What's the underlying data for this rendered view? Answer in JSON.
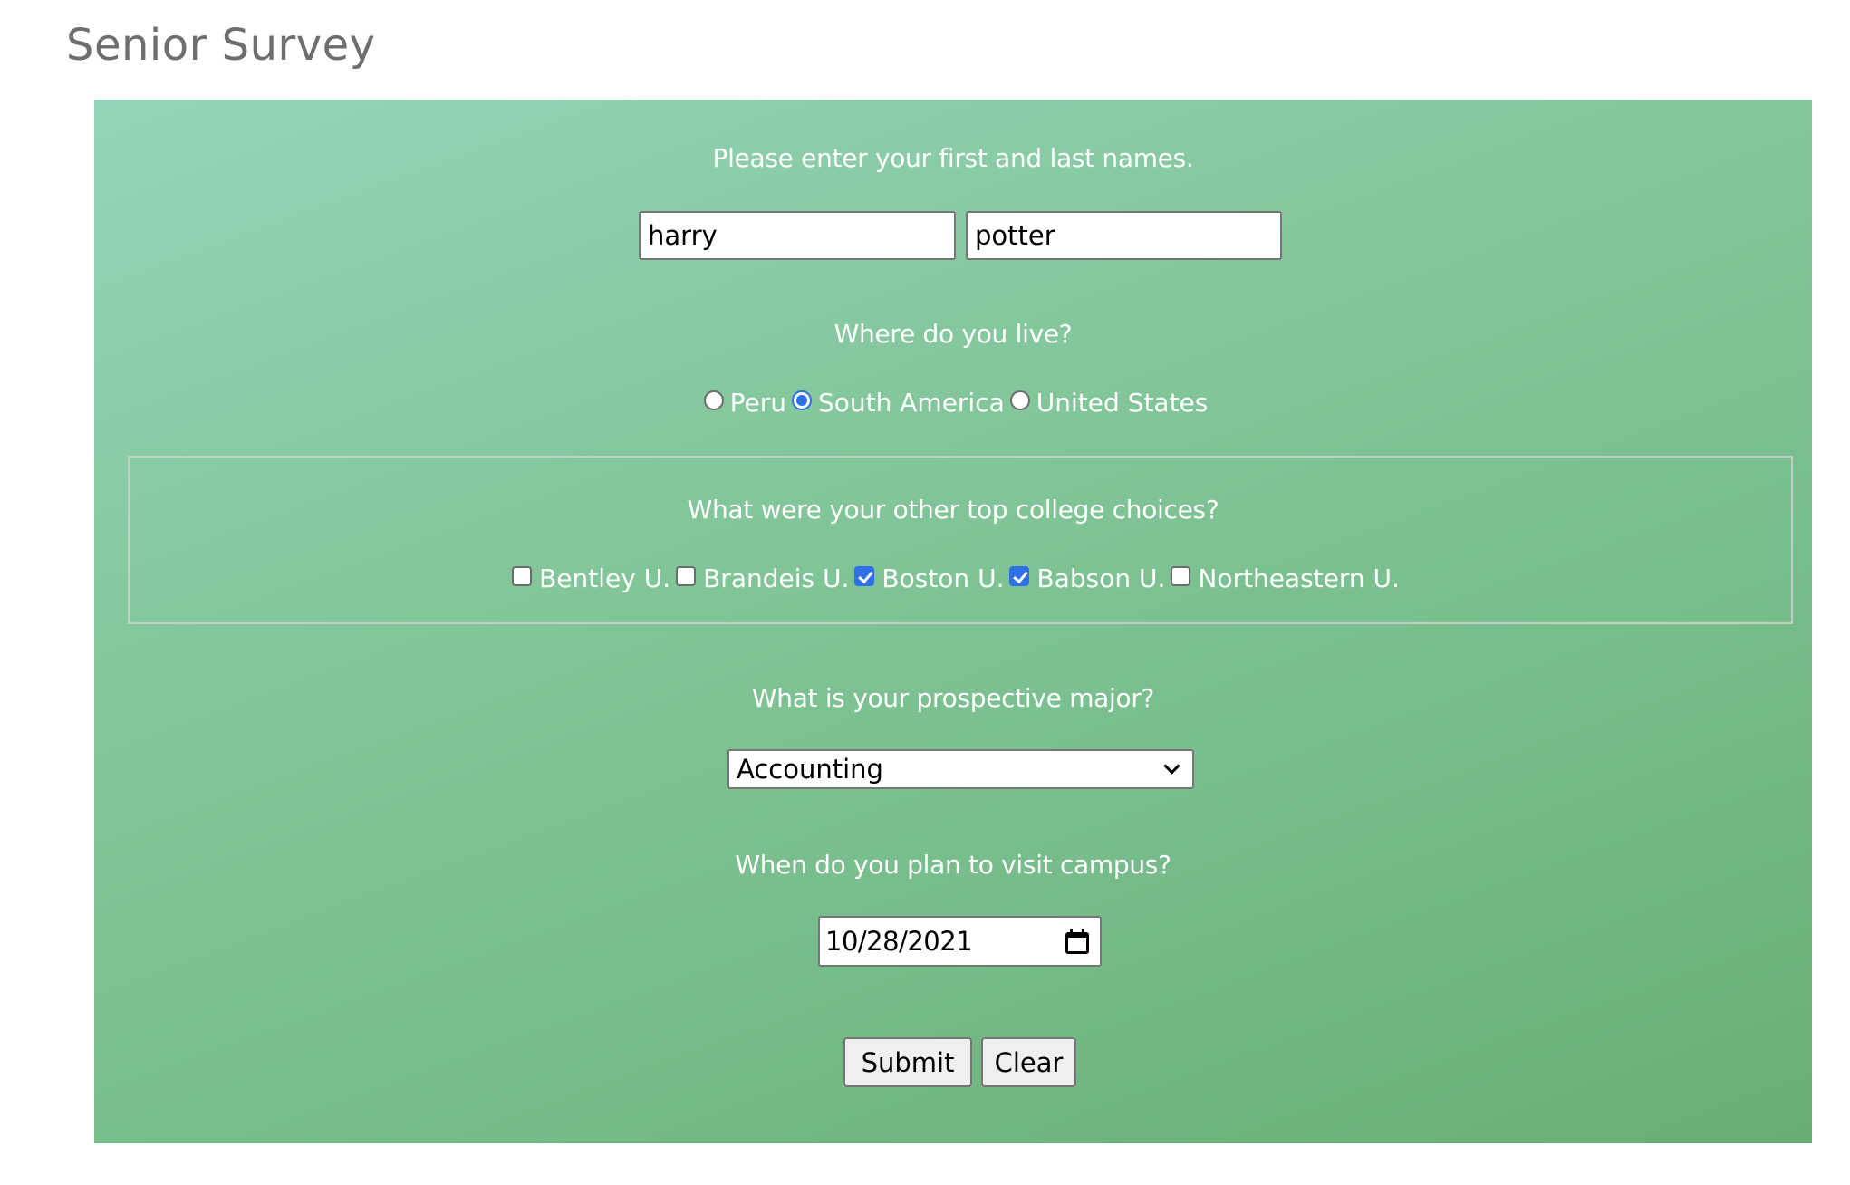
{
  "page": {
    "title": "Senior Survey"
  },
  "form": {
    "name_question": "Please enter your first and last names.",
    "first_name": {
      "value": "harry",
      "placeholder": ""
    },
    "last_name": {
      "value": "potter",
      "placeholder": ""
    },
    "location_question": "Where do you live?",
    "location_options": [
      {
        "label": "Peru",
        "checked": false
      },
      {
        "label": "South America",
        "checked": true
      },
      {
        "label": "United States",
        "checked": false
      }
    ],
    "college_question": "What were your other top college choices?",
    "college_options": [
      {
        "label": "Bentley U.",
        "checked": false
      },
      {
        "label": "Brandeis U.",
        "checked": false
      },
      {
        "label": "Boston U.",
        "checked": true
      },
      {
        "label": "Babson U.",
        "checked": true
      },
      {
        "label": "Northeastern U.",
        "checked": false
      }
    ],
    "major_question": "What is your prospective major?",
    "major_selected": "Accounting",
    "visit_question": "When do you plan to visit campus?",
    "visit_date": "10/28/2021",
    "submit_label": "Submit",
    "clear_label": "Clear"
  },
  "colors": {
    "accent": "#2f6fe8",
    "panel_gradient_start": "#94d4b8",
    "panel_gradient_end": "#68ae74",
    "title_text": "#6e6e6e",
    "question_text": "#ffffff"
  }
}
